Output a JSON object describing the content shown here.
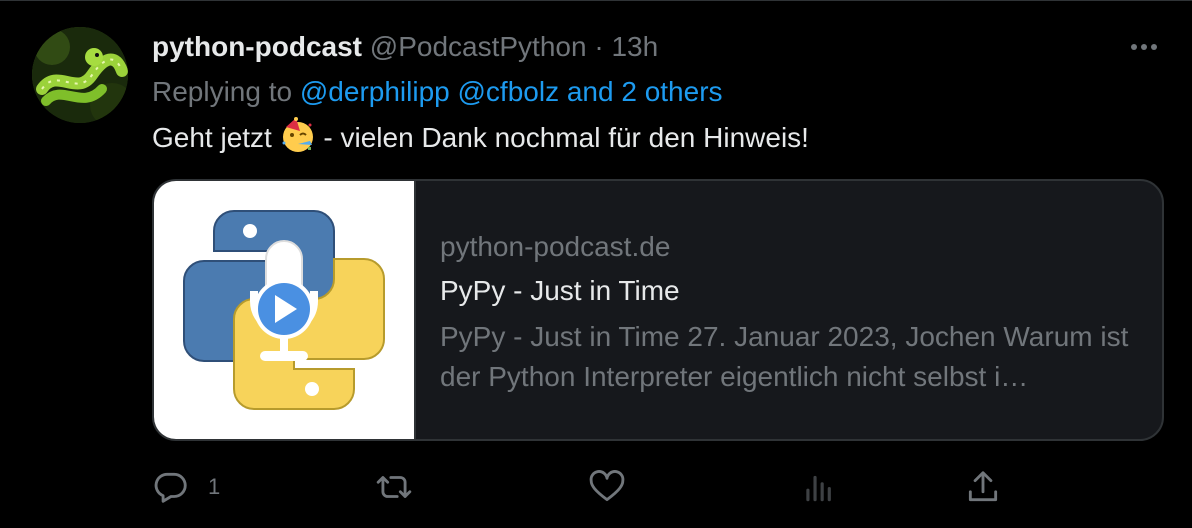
{
  "tweet": {
    "display_name": "python-podcast",
    "handle": "@PodcastPython",
    "separator": "·",
    "time": "13h",
    "more_icon": "more-horizontal-icon",
    "reply_prefix": "Replying to",
    "reply_mentions": "@derphilipp @cfbolz and 2 others",
    "text_before_emoji": "Geht jetzt",
    "emoji": "partying-face",
    "text_after_emoji": " - vielen Dank nochmal für den Hinweis!"
  },
  "card": {
    "domain": "python-podcast.de",
    "title": "PyPy - Just in Time",
    "description": "PyPy - Just in Time 27. Januar 2023, Jochen Warum ist der Python Interpreter eigentlich nicht selbst i…",
    "thumbnail": "python-podcast-logo"
  },
  "actions": {
    "reply_icon": "reply-icon",
    "reply_count": "1",
    "retweet_icon": "retweet-icon",
    "like_icon": "like-icon",
    "views_icon": "views-icon",
    "share_icon": "share-icon"
  },
  "colors": {
    "background": "#000000",
    "text": "#e7e9ea",
    "secondary": "#71767b",
    "link": "#1d9bf0",
    "border": "#2f3336",
    "python_blue": "#4b7bb0",
    "python_yellow": "#f7d35a"
  }
}
